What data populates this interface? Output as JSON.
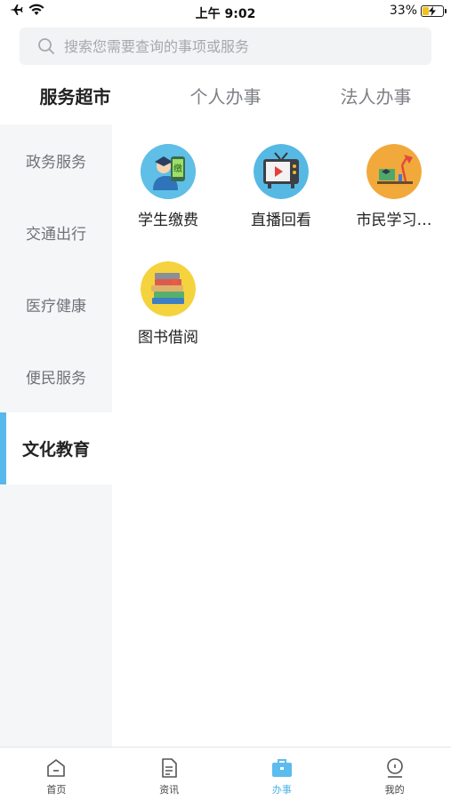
{
  "status_bar": {
    "time": "上午 9:02",
    "battery_text": "33%",
    "battery_level": 0.33,
    "icons": [
      "airplane-icon",
      "wifi-icon",
      "battery-charging-icon"
    ]
  },
  "search": {
    "placeholder": "搜索您需要查询的事项或服务"
  },
  "top_tabs": [
    {
      "label": "服务超市",
      "active": true
    },
    {
      "label": "个人办事",
      "active": false
    },
    {
      "label": "法人办事",
      "active": false
    }
  ],
  "sidebar": {
    "items": [
      {
        "label": "政务服务",
        "active": false
      },
      {
        "label": "交通出行",
        "active": false
      },
      {
        "label": "医疗健康",
        "active": false
      },
      {
        "label": "便民服务",
        "active": false
      },
      {
        "label": "文化教育",
        "active": true
      }
    ]
  },
  "services": [
    {
      "label": "学生缴费",
      "icon": "student-payment-icon",
      "icon_text": "缴"
    },
    {
      "label": "直播回看",
      "icon": "tv-replay-icon"
    },
    {
      "label": "市民学习…",
      "icon": "desk-lamp-icon"
    },
    {
      "label": "图书借阅",
      "icon": "books-icon"
    }
  ],
  "bottom_nav": [
    {
      "label": "首页",
      "icon": "home-icon",
      "active": false
    },
    {
      "label": "资讯",
      "icon": "news-icon",
      "active": false
    },
    {
      "label": "办事",
      "icon": "briefcase-icon",
      "active": true
    },
    {
      "label": "我的",
      "icon": "profile-icon",
      "active": false
    }
  ],
  "colors": {
    "accent": "#57b8ec",
    "sidebar_bg": "#f5f6f8",
    "search_bg": "#f2f3f5"
  }
}
